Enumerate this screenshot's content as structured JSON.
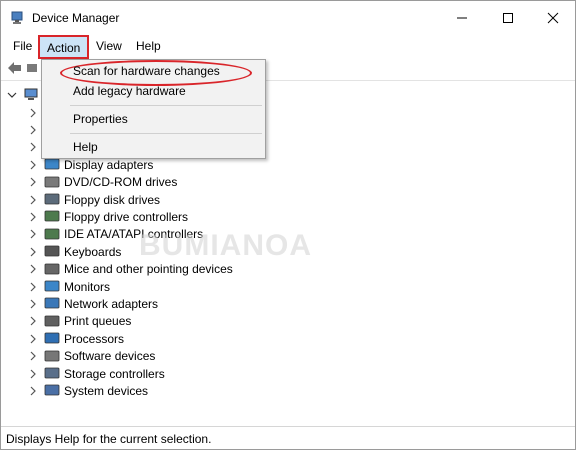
{
  "window": {
    "title": "Device Manager",
    "controls": {
      "minimize": "minimize-icon",
      "maximize": "maximize-icon",
      "close": "close-icon"
    }
  },
  "menubar": {
    "items": [
      {
        "label": "File"
      },
      {
        "label": "Action",
        "state": "open",
        "highlight_color": "#d9252a"
      },
      {
        "label": "View"
      },
      {
        "label": "Help"
      }
    ]
  },
  "action_menu": {
    "items": [
      {
        "label": "Scan for hardware changes",
        "circled": true
      },
      {
        "label": "Add legacy hardware"
      },
      {
        "label": "Properties"
      },
      {
        "label": "Help"
      }
    ]
  },
  "tree": {
    "root_icon": "computer-icon",
    "categories": [
      {
        "label": "",
        "icon": "device-icon"
      },
      {
        "label": "",
        "icon": "device-icon"
      },
      {
        "label": "",
        "icon": "device-icon"
      },
      {
        "label": "Display adapters",
        "icon": "monitor-icon"
      },
      {
        "label": "DVD/CD-ROM drives",
        "icon": "dvd-icon"
      },
      {
        "label": "Floppy disk drives",
        "icon": "floppy-icon"
      },
      {
        "label": "Floppy drive controllers",
        "icon": "controller-icon"
      },
      {
        "label": "IDE ATA/ATAPI controllers",
        "icon": "controller-icon"
      },
      {
        "label": "Keyboards",
        "icon": "keyboard-icon"
      },
      {
        "label": "Mice and other pointing devices",
        "icon": "mouse-icon"
      },
      {
        "label": "Monitors",
        "icon": "monitor-icon"
      },
      {
        "label": "Network adapters",
        "icon": "network-icon"
      },
      {
        "label": "Print queues",
        "icon": "printer-icon"
      },
      {
        "label": "Processors",
        "icon": "processor-icon"
      },
      {
        "label": "Software devices",
        "icon": "software-icon"
      },
      {
        "label": "Storage controllers",
        "icon": "storage-icon"
      },
      {
        "label": "System devices",
        "icon": "system-icon"
      }
    ]
  },
  "statusbar": {
    "text": "Displays Help for the current selection."
  },
  "watermark": {
    "text": "BUMIANOA"
  }
}
